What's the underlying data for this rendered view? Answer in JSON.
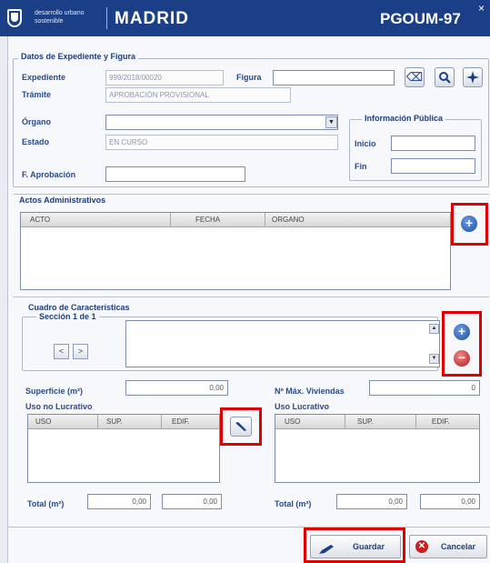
{
  "header": {
    "subtitle": "desarrollo urbano sostenible",
    "city": "MADRID",
    "app": "PGOUM-97",
    "close": "×"
  },
  "datos": {
    "legend": "Datos de Expediente y Figura",
    "expediente_label": "Expediente",
    "expediente_value": "999/2018/00020",
    "figura_label": "Figura",
    "figura_value": "",
    "tramite_label": "Trámite",
    "tramite_value": "APROBACIÓN PROVISIONAL",
    "organo_label": "Órgano",
    "organo_value": "",
    "estado_label": "Estado",
    "estado_value": "EN CURSO",
    "faprobacion_label": "F. Aprobación",
    "faprobacion_value": "",
    "info_publica": {
      "legend": "Información Pública",
      "inicio_label": "Inicio",
      "inicio_value": "",
      "fin_label": "Fin",
      "fin_value": ""
    }
  },
  "actos": {
    "legend": "Actos Administrativos",
    "columns": [
      "ACTO",
      "FECHA",
      "ORGANO"
    ]
  },
  "cuadro": {
    "legend": "Cuadro de Características",
    "seccion_legend": "Sección 1 de 1",
    "prev": "<",
    "next": ">",
    "superficie_label": "Superficie (m²)",
    "superficie_value": "0,00",
    "viviendas_label": "Nº Máx. Viviendas",
    "viviendas_value": "0",
    "uso_no_lucrativo": {
      "title": "Uso no Lucrativo",
      "columns": [
        "USO",
        "SUP.",
        "EDIF."
      ],
      "total_label": "Total (m²)",
      "total_sup": "0,00",
      "total_edif": "0,00"
    },
    "uso_lucrativo": {
      "title": "Uso Lucrativo",
      "columns": [
        "USO",
        "SUP.",
        "EDIF."
      ],
      "total_label": "Total (m²)",
      "total_sup": "0,00",
      "total_edif": "0,00"
    }
  },
  "footer": {
    "guardar": "Guardar",
    "cancelar": "Cancelar"
  },
  "colors": {
    "header_bg": "#1b3f86",
    "highlight": "#e00000"
  }
}
